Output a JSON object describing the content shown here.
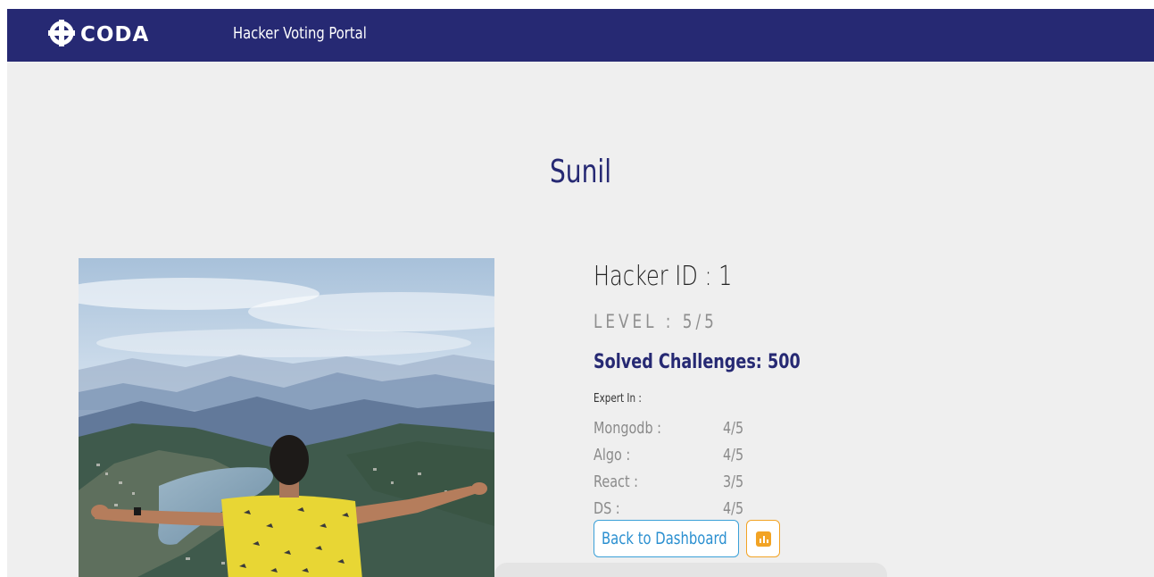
{
  "header": {
    "logo_text": "CODA",
    "logo_icon": "coda-cross-icon",
    "portal_title": "Hacker Voting Portal"
  },
  "profile": {
    "name": "Sunil",
    "photo_alt": "profile-photo",
    "hacker_id_label": "Hacker ID : 1",
    "level_label": "LEVEL : 5/5",
    "solved_label": "Solved Challenges: 500",
    "expert_heading": "Expert In :",
    "skills": [
      {
        "name": "Mongodb :",
        "score": "4/5"
      },
      {
        "name": "Algo :",
        "score": "4/5"
      },
      {
        "name": "React :",
        "score": "3/5"
      },
      {
        "name": "DS :",
        "score": "4/5"
      }
    ]
  },
  "actions": {
    "back_label": "Back to Dashboard",
    "stats_icon": "bar-chart-icon"
  },
  "colors": {
    "navbar": "#262973",
    "accent": "#262973",
    "back_button": "#2a8fd0",
    "stats_button": "#f2a324",
    "background": "#efefef"
  }
}
